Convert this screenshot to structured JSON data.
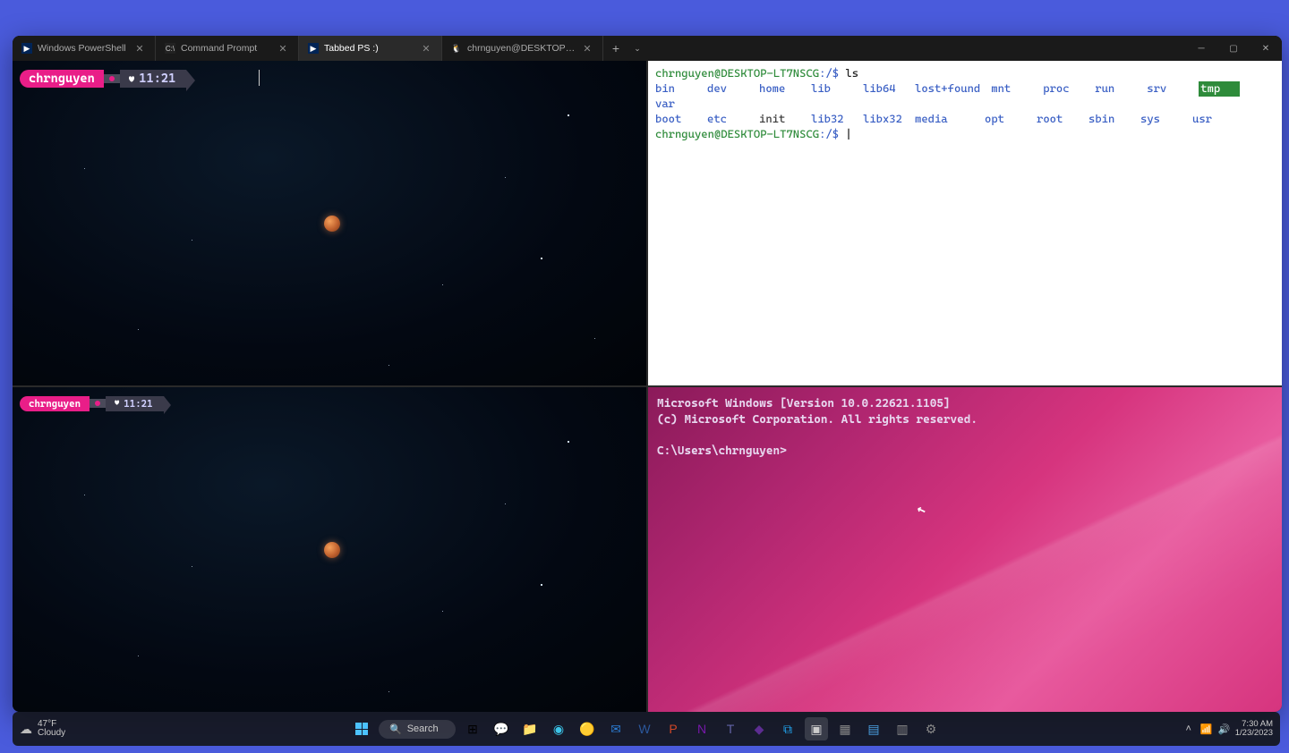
{
  "tabs": [
    {
      "label": "Windows PowerShell",
      "icon": "ps"
    },
    {
      "label": "Command Prompt",
      "icon": "cmd"
    },
    {
      "label": "Tabbed PS :)",
      "icon": "ps",
      "active": true
    },
    {
      "label": "chrnguyen@DESKTOP-LT7NSC",
      "icon": "linux"
    }
  ],
  "space_pane": {
    "user": "chrnguyen",
    "time": "11:21"
  },
  "wsl_pane": {
    "prompt_user": "chrnguyen@DESKTOP-LT7NSCG",
    "prompt_path": ":/$",
    "command": "ls",
    "entries": {
      "row1": [
        "bin",
        "dev",
        "home",
        "lib",
        "lib64",
        "lost+found",
        "mnt",
        "proc",
        "run",
        "srv",
        "tmp",
        "var"
      ],
      "row2": [
        "boot",
        "etc",
        "init",
        "lib32",
        "libx32",
        "media",
        "opt",
        "root",
        "sbin",
        "sys",
        "usr"
      ]
    }
  },
  "cmd_pane": {
    "line1": "Microsoft Windows [Version 10.0.22621.1105]",
    "line2": "(c) Microsoft Corporation. All rights reserved.",
    "prompt": "C:\\Users\\chrnguyen>"
  },
  "taskbar": {
    "weather_temp": "47°F",
    "weather_cond": "Cloudy",
    "search": "Search",
    "time": "7:30 AM",
    "date": "1/23/2023"
  }
}
